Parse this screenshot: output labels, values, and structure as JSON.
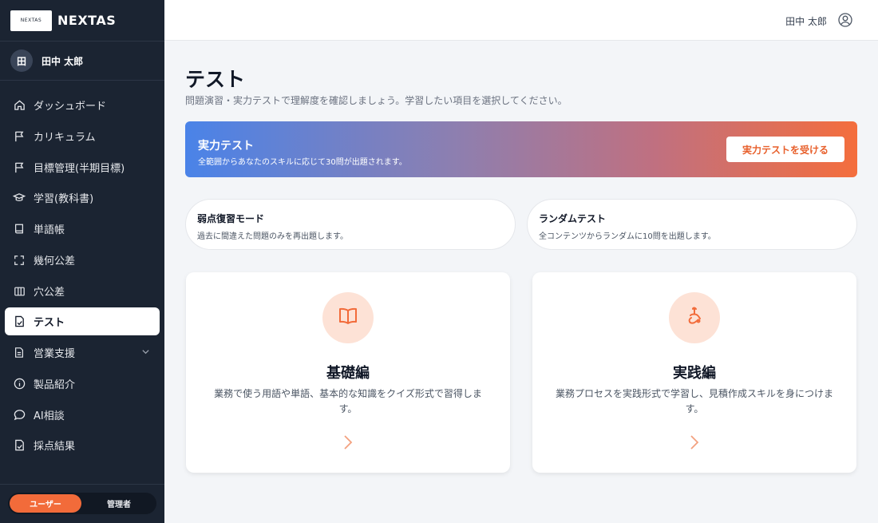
{
  "brand": {
    "logo_text": "NEXTAS",
    "name": "NEXTAS"
  },
  "user": {
    "initial": "田",
    "name": "田中 太郎"
  },
  "nav": [
    {
      "label": "ダッシュボード",
      "icon": "home-icon"
    },
    {
      "label": "カリキュラム",
      "icon": "flag-icon"
    },
    {
      "label": "目標管理(半期目標)",
      "icon": "flag-icon"
    },
    {
      "label": "学習(教科書)",
      "icon": "graduation-cap-icon"
    },
    {
      "label": "単語帳",
      "icon": "book-icon"
    },
    {
      "label": "幾何公差",
      "icon": "expand-icon"
    },
    {
      "label": "穴公差",
      "icon": "columns-icon"
    },
    {
      "label": "テスト",
      "icon": "test-icon",
      "active": true
    },
    {
      "label": "営業支援",
      "icon": "document-icon",
      "has_submenu": true
    },
    {
      "label": "製品紹介",
      "icon": "info-icon"
    },
    {
      "label": "AI相談",
      "icon": "chat-icon"
    },
    {
      "label": "採点結果",
      "icon": "result-icon"
    }
  ],
  "role_toggle": {
    "user_label": "ユーザー",
    "admin_label": "管理者",
    "selected": "user"
  },
  "header": {
    "user_name": "田中 太郎",
    "icon": "user-circle-icon"
  },
  "page": {
    "title": "テスト",
    "description": "問題演習・実力テストで理解度を確認しましょう。学習したい項目を選択してください。"
  },
  "banner": {
    "title": "実力テスト",
    "description": "全範囲からあなたのスキルに応じて30問が出題されます。",
    "button_label": "実力テストを受ける"
  },
  "modes": [
    {
      "title": "弱点復習モード",
      "description": "過去に間違えた問題のみを再出題します。"
    },
    {
      "title": "ランダムテスト",
      "description": "全コンテンツからランダムに10問を出題します。"
    }
  ],
  "courses": [
    {
      "title": "基礎編",
      "description": "業務で使う用語や単語、基本的な知識をクイズ形式で習得します。",
      "icon": "open-book-icon"
    },
    {
      "title": "実践編",
      "description": "業務プロセスを実践形式で学習し、見積作成スキルを身につけます。",
      "icon": "practice-icon"
    }
  ],
  "colors": {
    "accent": "#f26b3a",
    "sidebar_bg": "#1b2432",
    "main_bg": "#f3f5f8"
  }
}
